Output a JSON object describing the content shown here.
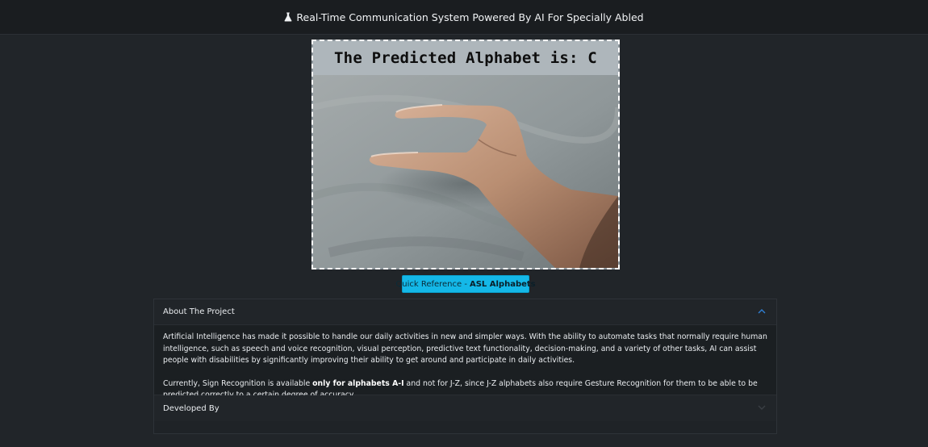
{
  "header": {
    "title": "Real-Time Communication System Powered By AI For Specially Abled",
    "icon": "flask-icon"
  },
  "video": {
    "prediction_text": "The Predicted Alphabet is: C"
  },
  "quick_reference": {
    "label_prefix": "Quick Reference - ",
    "label_bold": "ASL Alphabets"
  },
  "accordion": {
    "about": {
      "title": "About The Project",
      "expanded": true,
      "paragraph1": "Artificial Intelligence has made it possible to handle our daily activities in new and simpler ways. With the ability to automate tasks that normally require human intelligence, such as speech and voice recognition, visual perception, predictive text functionality, decision-making, and a variety of other tasks, AI can assist people with disabilities by significantly improving their ability to get around and participate in daily activities.",
      "paragraph2_before": "Currently, Sign Recognition is available ",
      "paragraph2_bold": "only for alphabets A-I",
      "paragraph2_after": " and not for J-Z, since J-Z alphabets also require Gesture Recognition for them to be able to be predicted correctly to a certain degree of accuracy."
    },
    "developed_by": {
      "title": "Developed By",
      "expanded": false
    }
  },
  "colors": {
    "background": "#212529",
    "accent_button": "#14b8e8",
    "chevron": "#2f7fd3"
  }
}
